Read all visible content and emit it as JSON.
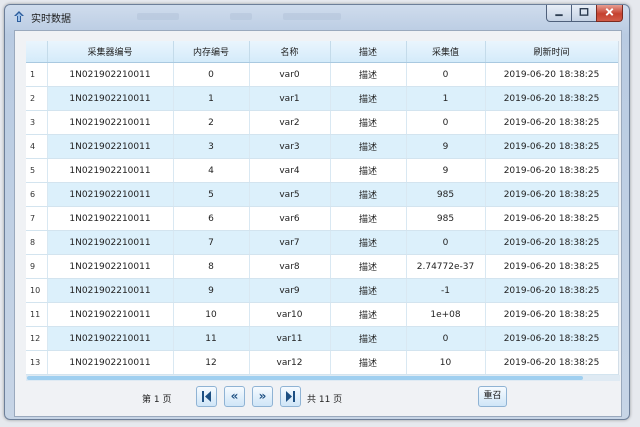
{
  "window": {
    "title": "实时数据"
  },
  "table": {
    "columns": [
      "",
      "采集器编号",
      "内存编号",
      "名称",
      "描述",
      "采集值",
      "刷新时间"
    ],
    "rows": [
      [
        "1",
        "1N021902210011",
        "0",
        "var0",
        "描述",
        "0",
        "2019-06-20 18:38:25"
      ],
      [
        "2",
        "1N021902210011",
        "1",
        "var1",
        "描述",
        "1",
        "2019-06-20 18:38:25"
      ],
      [
        "3",
        "1N021902210011",
        "2",
        "var2",
        "描述",
        "0",
        "2019-06-20 18:38:25"
      ],
      [
        "4",
        "1N021902210011",
        "3",
        "var3",
        "描述",
        "9",
        "2019-06-20 18:38:25"
      ],
      [
        "5",
        "1N021902210011",
        "4",
        "var4",
        "描述",
        "9",
        "2019-06-20 18:38:25"
      ],
      [
        "6",
        "1N021902210011",
        "5",
        "var5",
        "描述",
        "985",
        "2019-06-20 18:38:25"
      ],
      [
        "7",
        "1N021902210011",
        "6",
        "var6",
        "描述",
        "985",
        "2019-06-20 18:38:25"
      ],
      [
        "8",
        "1N021902210011",
        "7",
        "var7",
        "描述",
        "0",
        "2019-06-20 18:38:25"
      ],
      [
        "9",
        "1N021902210011",
        "8",
        "var8",
        "描述",
        "2.74772e-37",
        "2019-06-20 18:38:25"
      ],
      [
        "10",
        "1N021902210011",
        "9",
        "var9",
        "描述",
        "-1",
        "2019-06-20 18:38:25"
      ],
      [
        "11",
        "1N021902210011",
        "10",
        "var10",
        "描述",
        "1e+08",
        "2019-06-20 18:38:25"
      ],
      [
        "12",
        "1N021902210011",
        "11",
        "var11",
        "描述",
        "0",
        "2019-06-20 18:38:25"
      ],
      [
        "13",
        "1N021902210011",
        "12",
        "var12",
        "描述",
        "10",
        "2019-06-20 18:38:25"
      ]
    ]
  },
  "pager": {
    "page_label": "第 1 页",
    "first": "first-page",
    "prev": "«",
    "next": "»",
    "last": "last-page",
    "total_label": "共 11 页",
    "refresh_label": "重召"
  }
}
